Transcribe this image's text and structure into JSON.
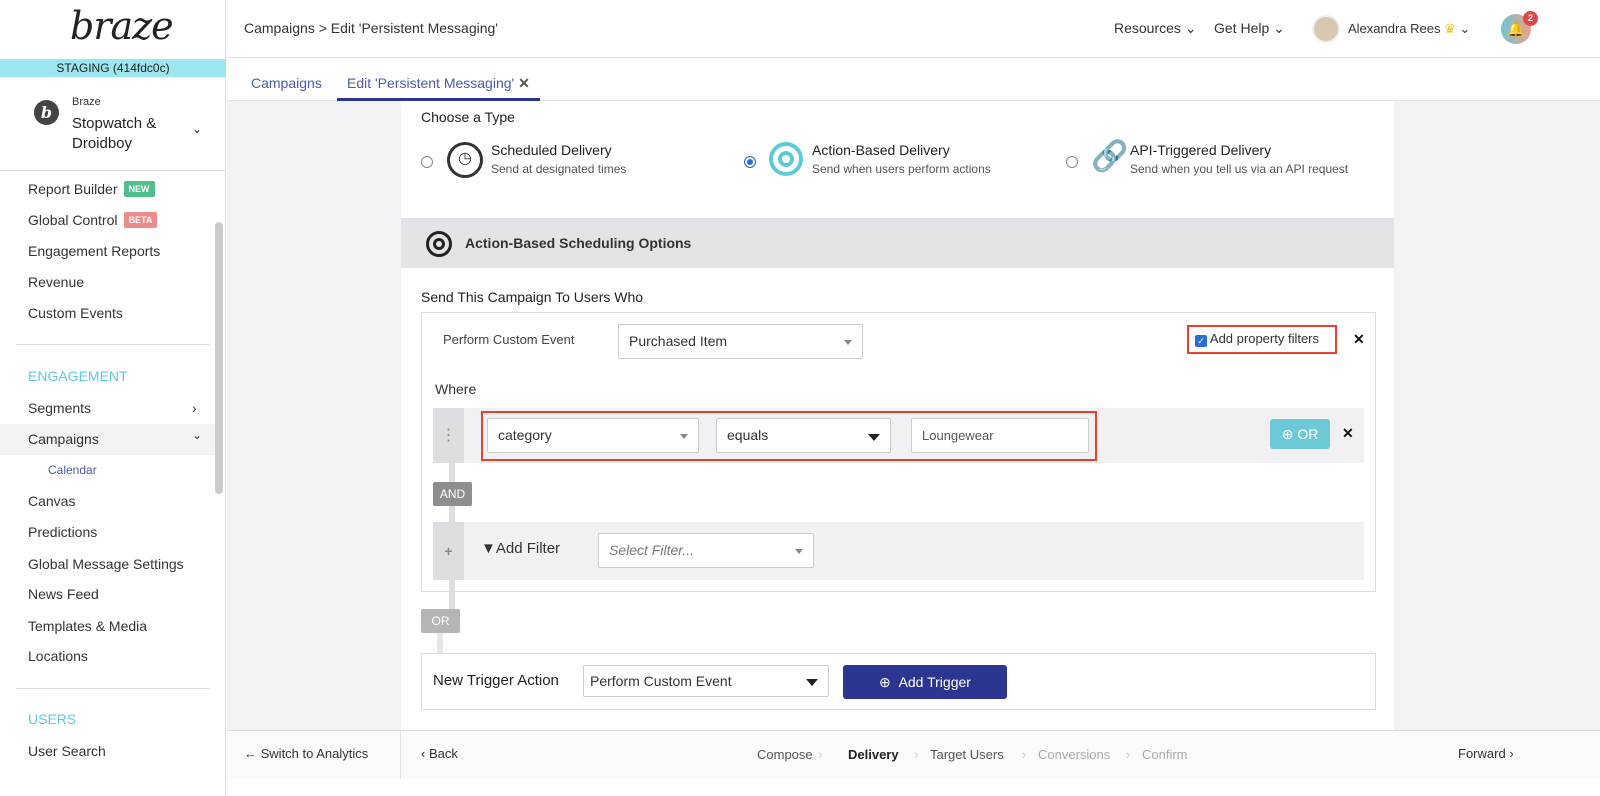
{
  "sidebar": {
    "logo": "braze",
    "env": "STAGING (414fdc0c)",
    "org_label": "Braze",
    "app_name": "Stopwatch & Droidboy",
    "items": [
      {
        "label": "Report Builder",
        "badge": "NEW"
      },
      {
        "label": "Global Control",
        "badge": "BETA"
      },
      {
        "label": "Engagement Reports"
      },
      {
        "label": "Revenue"
      },
      {
        "label": "Custom Events"
      }
    ],
    "engagement_title": "ENGAGEMENT",
    "engagement": [
      {
        "label": "Segments"
      },
      {
        "label": "Campaigns"
      },
      {
        "label": "Calendar"
      },
      {
        "label": "Canvas"
      },
      {
        "label": "Predictions"
      },
      {
        "label": "Global Message Settings"
      },
      {
        "label": "News Feed"
      },
      {
        "label": "Templates & Media"
      },
      {
        "label": "Locations"
      }
    ],
    "users_title": "USERS",
    "users": [
      {
        "label": "User Search"
      }
    ],
    "switch": "Switch to Analytics"
  },
  "header": {
    "breadcrumb": "Campaigns > Edit 'Persistent Messaging'",
    "resources": "Resources",
    "help": "Get Help",
    "user": "Alexandra Rees",
    "notifications": "2"
  },
  "tabs": [
    {
      "label": "Campaigns"
    },
    {
      "label": "Edit 'Persistent Messaging'"
    }
  ],
  "main": {
    "choose_type": "Choose a Type",
    "types": [
      {
        "title": "Scheduled Delivery",
        "desc": "Send at designated times"
      },
      {
        "title": "Action-Based Delivery",
        "desc": "Send when users perform actions"
      },
      {
        "title": "API-Triggered Delivery",
        "desc": "Send when you tell us via an API request"
      }
    ],
    "section_title": "Action-Based Scheduling Options",
    "send_to": "Send This Campaign To Users Who",
    "trigger_label": "Perform Custom Event",
    "trigger_value": "Purchased Item",
    "add_property": "Add property filters",
    "where": "Where",
    "filter": {
      "property": "category",
      "operator": "equals",
      "value": "Loungewear"
    },
    "or_btn": "OR",
    "and": "AND",
    "add_filter": "Add Filter",
    "select_filter_placeholder": "Select Filter...",
    "or_label": "OR",
    "new_trigger": "New Trigger Action",
    "new_trigger_value": "Perform Custom Event",
    "add_trigger": "Add Trigger"
  },
  "footer": {
    "back": "Back",
    "forward": "Forward",
    "steps": [
      "Compose",
      "Delivery",
      "Target Users",
      "Conversions",
      "Confirm"
    ]
  },
  "colors": {
    "accent": "#5ecad9",
    "primary": "#2c3691",
    "highlight": "#e8412c"
  }
}
